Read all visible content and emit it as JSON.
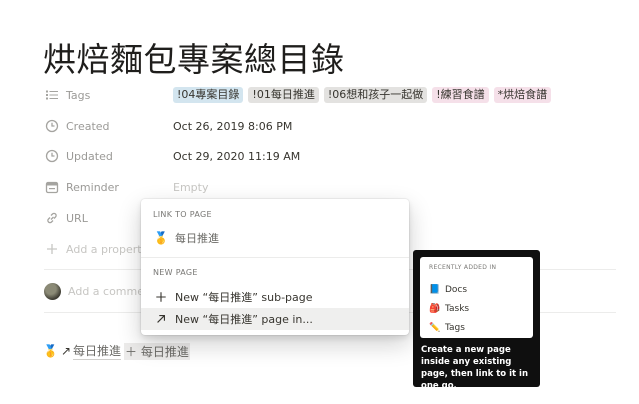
{
  "page": {
    "title": "烘焙麵包專案總目錄"
  },
  "properties": {
    "tags": {
      "icon": "list-icon",
      "label": "Tags",
      "values": [
        {
          "text": "!04專案目錄",
          "color": "#d3e5ef"
        },
        {
          "text": "!01每日推進",
          "color": "#e3e2e0"
        },
        {
          "text": "!06想和孩子一起做",
          "color": "#e3e2e0"
        },
        {
          "text": "!練習食譜",
          "color": "#f5e0e9"
        },
        {
          "text": "*烘焙食譜",
          "color": "#f5e0e9"
        }
      ]
    },
    "created": {
      "icon": "clock-icon",
      "label": "Created",
      "value": "Oct 26, 2019 8:06 PM"
    },
    "updated": {
      "icon": "clock-icon",
      "label": "Updated",
      "value": "Oct 29, 2020 11:19 AM"
    },
    "reminder": {
      "icon": "calendar-icon",
      "label": "Reminder",
      "value": "Empty"
    },
    "url": {
      "icon": "link-icon",
      "label": "URL"
    },
    "add": {
      "icon": "plus-icon",
      "label": "Add a property"
    }
  },
  "comment": {
    "placeholder": "Add a comment"
  },
  "editor": {
    "medal": "🥇",
    "link_text": "每日推進",
    "query": "＋ 每日推進"
  },
  "popup": {
    "link_section": "LINK TO PAGE",
    "link_item": {
      "icon": "medal-icon",
      "emoji": "🥇",
      "label": "每日推進"
    },
    "new_section": "NEW PAGE",
    "subpage_item": {
      "icon": "plus-icon",
      "label": "New “每日推進” sub-page"
    },
    "pagein_item": {
      "icon": "arrow-up-right-icon",
      "label": "New “每日推進” page in..."
    }
  },
  "tooltip": {
    "card_title": "RECENTLY ADDED IN",
    "items": [
      {
        "emoji": "📘",
        "label": "Docs"
      },
      {
        "emoji": "🎒",
        "label": "Tasks"
      },
      {
        "emoji": "✏️",
        "label": "Tags"
      }
    ],
    "text": "Create a new page inside any existing page, then link to it in one go."
  }
}
